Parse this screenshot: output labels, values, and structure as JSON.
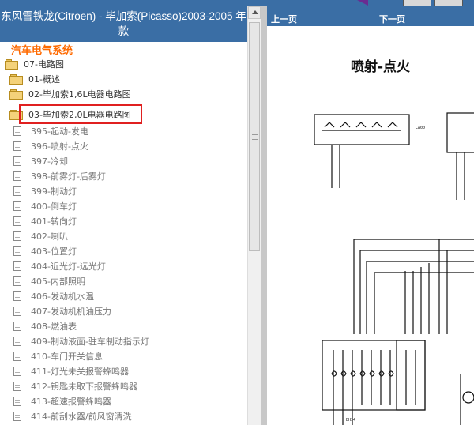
{
  "window": {
    "left_pane_title": "东风雪铁龙(Citroen) - 毕加索(Picasso)2003-2005 年款"
  },
  "tree": {
    "section_title": "汽车电气系统",
    "root_folder": "07-电路图",
    "folders": [
      "01-概述",
      "02-毕加索1,6L电器电路图",
      "03-毕加索2,0L电器电路图"
    ],
    "leaves": [
      "395-起动-发电",
      "396-喷射-点火",
      "397-冷却",
      "398-前雾灯-后雾灯",
      "399-制动灯",
      "400-倒车灯",
      "401-转向灯",
      "402-喇叭",
      "403-位置灯",
      "404-近光灯-远光灯",
      "405-内部照明",
      "406-发动机水温",
      "407-发动机机油压力",
      "408-燃油表",
      "409-制动液面-驻车制动指示灯",
      "410-车门开关信息",
      "411-灯光未关报警蜂鸣器",
      "412-钥匙未取下报警蜂鸣器",
      "413-超速报警蜂鸣器",
      "414-前刮水器/前风窗清洗",
      "415-后刮水器/后风窗清洗"
    ]
  },
  "viewer": {
    "prev_page": "上一页",
    "next_page": "下一页",
    "diagram_title": "喷射-点火",
    "diagram_labels": {
      "connector_top": "CA00",
      "connector_bottom": "BH34",
      "fuse_prefix": "F"
    }
  },
  "colors": {
    "header_blue": "#3a6ea5",
    "section_orange": "#ff6a00",
    "highlight_red": "#e02020",
    "folder_yellow": "#f4d27a"
  }
}
